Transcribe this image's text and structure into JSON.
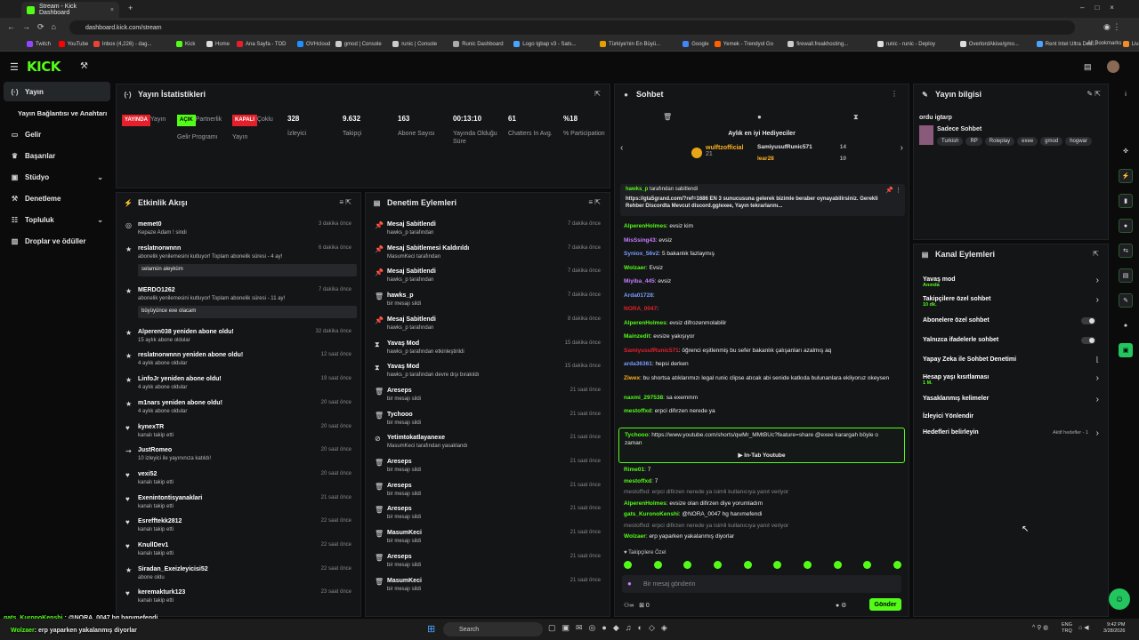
{
  "browser": {
    "tab_title": "Stream - Kick Dashboard",
    "url": "dashboard.kick.com/stream",
    "bookmarks": [
      "Twitch",
      "YouTube",
      "Inbox (4,226) - dag...",
      "Kick",
      "Home",
      "Ana Sayfa - TOD",
      "OVHcloud",
      "gmod | Console",
      "runic | Console",
      "Runic Dashboard",
      "Logo Igbap v3 - Sats...",
      "Türkiye'nin En Büyü...",
      "Google",
      "Yemek - Trendyol Go",
      "firewall.freakhosting...",
      "runic - runic - Deploy",
      "OverlordAkise/gmo...",
      "Rent Intel Ultra Ded...",
      "Livad For Streamers"
    ],
    "all_bookmarks": "All Bookmarks"
  },
  "app": {
    "logo": "KICK"
  },
  "sidebar": {
    "items": [
      {
        "label": "Yayın",
        "active": true
      },
      {
        "label": "Yayın Bağlantısı ve Anahtarı"
      },
      {
        "label": "Gelir"
      },
      {
        "label": "Başarılar"
      },
      {
        "label": "Stüdyo"
      },
      {
        "label": "Denetleme"
      },
      {
        "label": "Topluluk"
      },
      {
        "label": "Droplar ve ödüller"
      }
    ]
  },
  "stats": {
    "title": "Yayın İstatistikleri",
    "items": [
      {
        "value": "YAYINDA",
        "label": "Yayın",
        "color": "#e5202b"
      },
      {
        "value": "AÇIK",
        "label": "Partnerlik Gelir Programı",
        "color": "#53fc18"
      },
      {
        "value": "KAPALI",
        "label": "Çoklu Yayın",
        "color": "#e5202b"
      },
      {
        "value": "328",
        "label": "İzleyici"
      },
      {
        "value": "9.632",
        "label": "Takipçi"
      },
      {
        "value": "163",
        "label": "Abone Sayısı"
      },
      {
        "value": "00:13:10",
        "label": "Yayında Olduğu Süre"
      },
      {
        "value": "61",
        "label": "Chatters In Avg."
      },
      {
        "value": "%18",
        "label": "% Participation"
      }
    ]
  },
  "activity": {
    "title": "Etkinlik Akışı",
    "items": [
      {
        "t": "memet0",
        "s": "Kepaze Adam ! sindi",
        "time": "3 dakika önce"
      },
      {
        "t": "reslatnorwnnn",
        "s": "abonelik yenilemesini kutluyor! Toplam abonelik süresi - 4 ay!",
        "q": "selamün aleyküm",
        "time": "6 dakika önce"
      },
      {
        "t": "MERDO1262",
        "s": "abonelik yenilemesini kutluyor! Toplam abonelik süresi - 11 ay!",
        "q": "büyüyünce exe olacam",
        "time": "7 dakika önce"
      },
      {
        "t": "Alperen038 yeniden abone oldu!",
        "s": "15 aylık abone oldular",
        "time": "32 dakika önce"
      },
      {
        "t": "reslatnorwnnn yeniden abone oldu!",
        "s": "4 aylık abone oldular",
        "time": "12 saat önce"
      },
      {
        "t": "LinfoJr yeniden abone oldu!",
        "s": "4 aylık abone oldular",
        "time": "19 saat önce"
      },
      {
        "t": "m1nars yeniden abone oldu!",
        "s": "4 aylık abone oldular",
        "time": "20 saat önce"
      },
      {
        "t": "kynexTR",
        "s": "kanalı takip etti",
        "time": "20 saat önce"
      },
      {
        "t": "JustRomeo",
        "s": "10 izleyici ile yayınınıza katıldı!",
        "time": "20 saat önce"
      },
      {
        "t": "vexi52",
        "s": "kanalı takip etti",
        "time": "20 saat önce"
      },
      {
        "t": "Exenintontisyanaklari",
        "s": "kanalı takip etti",
        "time": "21 saat önce"
      },
      {
        "t": "Esrefftekk2812",
        "s": "kanalı takip etti",
        "time": "22 saat önce"
      },
      {
        "t": "KnullDev1",
        "s": "kanalı takip etti",
        "time": "22 saat önce"
      },
      {
        "t": "Siradan_Exeizleyicisi52",
        "s": "abone oldu",
        "time": "22 saat önce"
      },
      {
        "t": "keremakturk123",
        "s": "kanalı takip etti",
        "time": "23 saat önce"
      }
    ]
  },
  "modlog": {
    "title": "Denetim Eylemleri",
    "items": [
      {
        "t": "Mesaj Sabitlendi",
        "s": "hawks_p tarafından",
        "time": "7 dakika önce"
      },
      {
        "t": "Mesaj Sabitlemesi Kaldırıldı",
        "s": "MasumKeci tarafından",
        "time": "7 dakika önce"
      },
      {
        "t": "Mesaj Sabitlendi",
        "s": "hawks_p tarafından",
        "time": "7 dakika önce"
      },
      {
        "t": "hawks_p",
        "s": "bir mesajı sildi",
        "time": "7 dakika önce"
      },
      {
        "t": "Mesaj Sabitlendi",
        "s": "hawks_p tarafından",
        "time": "8 dakika önce"
      },
      {
        "t": "Yavaş Mod",
        "s": "hawks_p tarafından etkinleştirildi",
        "time": "15 dakika önce"
      },
      {
        "t": "Yavaş Mod",
        "s": "hawks_p tarafından devre dışı bırakıldı",
        "time": "15 dakika önce"
      },
      {
        "t": "Areseps",
        "s": "bir mesajı sildi",
        "time": "21 saat önce"
      },
      {
        "t": "Tychooo",
        "s": "bir mesajı sildi",
        "time": "21 saat önce"
      },
      {
        "t": "Yetimtokatlayanexe",
        "s": "MasumKeci tarafından yasaklandı",
        "time": "21 saat önce"
      },
      {
        "t": "Areseps",
        "s": "bir mesajı sildi",
        "time": "21 saat önce"
      },
      {
        "t": "Areseps",
        "s": "bir mesajı sildi",
        "time": "21 saat önce"
      },
      {
        "t": "Areseps",
        "s": "bir mesajı sildi",
        "time": "21 saat önce"
      },
      {
        "t": "MasumKeci",
        "s": "bir mesajı sildi",
        "time": "21 saat önce"
      },
      {
        "t": "Areseps",
        "s": "bir mesajı sildi",
        "time": "21 saat önce"
      },
      {
        "t": "MasumKeci",
        "s": "bir mesajı sildi",
        "time": "21 saat önce"
      }
    ]
  },
  "chat": {
    "title": "Sohbet",
    "gifters_title": "Aylık en iyi Hediyeciler",
    "gifters": [
      {
        "name": "wulftzofficial",
        "n": "21"
      },
      {
        "name": "SamiyusufRunic571",
        "n": "14"
      },
      {
        "name": "lear28",
        "n": "10"
      }
    ],
    "pinned_user": "hawks_p",
    "pinned_by": "tarafından sabitlendi",
    "pinned_text": "https://gta5grand.com/?ref=1686 EN 3 sunucusuna gelerek bizimle beraber oynayabilirsiniz. Gerekli Rehber Discordta Mevcut discord.gg/exee, Yayın tekrarlarını...",
    "messages": [
      {
        "u": "AlperenHolmes",
        "c": "#53fc18",
        "m": "evsiz kim"
      },
      {
        "u": "MisSsing43",
        "c": "#c77dff",
        "m": "evsiz"
      },
      {
        "u": "Syniox_56v2",
        "c": "#7b9cff",
        "m": "5 bakanlık fazlaymış"
      },
      {
        "u": "Wolzaer",
        "c": "#53fc18",
        "m": "Evsiz"
      },
      {
        "u": "Miyiba_445",
        "c": "#c77dff",
        "m": "evsiz"
      },
      {
        "u": "Arda01728",
        "c": "#7b9cff",
        "m": ""
      },
      {
        "u": "NORA_0047",
        "c": "#e5202b",
        "m": ""
      },
      {
        "u": "AlperenHolmes",
        "c": "#53fc18",
        "m": "evsiz difrozenmolabilir"
      },
      {
        "u": "Mainzedit",
        "c": "#53fc18",
        "m": "evsize yakışıyor"
      },
      {
        "u": "SamiyusufRunic571",
        "c": "#e5202b",
        "m": "öğrenci eşitlenmiş bu sefer bakanlık çalışanları azalmış aq"
      },
      {
        "u": "arda36361",
        "c": "#7b9cff",
        "m": "hepsi derken"
      },
      {
        "u": "Ziwex",
        "c": "#ffb020",
        "m": "bu shortsa atıklarımızı legal runic clipse atıcak abi senide katkıda bulunanlara ekliyoruz okeysen"
      },
      {
        "u": "naxmi_297538",
        "c": "#53fc18",
        "m": "sa exemmm"
      },
      {
        "u": "mestoffxd",
        "c": "#53fc18",
        "m": "erpci difırzen nerede ya"
      }
    ],
    "highlight_user": "Tychooo",
    "highlight_text": "https://www.youtube.com/shorts/qwMr_MMtBUc?feature=share @exee karargah böyle o zaman",
    "highlight_button": "In-Tab Youtube",
    "messages2": [
      {
        "u": "Rime01",
        "c": "#53fc18",
        "m": "7"
      },
      {
        "u": "mestoffxd",
        "c": "#53fc18",
        "m": "7"
      },
      {
        "u": "",
        "c": "#888",
        "m": "mestoffxd: erpci difirzen nerede ya isimli kullanıcıya yanıt veriyor"
      },
      {
        "u": "AlperenHolmes",
        "c": "#53fc18",
        "m": "evsize olan difirzen diye yorumladım"
      },
      {
        "u": "gats_KuronoKenshi",
        "c": "#53fc18",
        "m": "@NORA_0047 hg hanımefendi"
      },
      {
        "u": "",
        "c": "#888",
        "m": "mestoffxd: erpci difirzen nerede ya isimli kullanıcıya yanıt veriyor"
      },
      {
        "u": "Wolzaer",
        "c": "#53fc18",
        "m": "erp yaparken yakalanmış diyorlar"
      }
    ],
    "followers_only": "Takipçilere Özel",
    "input_placeholder": "Bir mesaj gönderin",
    "send": "Gönder",
    "points": "0"
  },
  "info": {
    "title": "Yayın bilgisi",
    "stream_title": "ordu igtarp",
    "category": "Sadece Sohbet",
    "tags": [
      "Turkish",
      "RP",
      "Roleplay",
      "exee",
      "gmod",
      "hogwar"
    ]
  },
  "actions": {
    "title": "Kanal Eylemleri",
    "items": [
      {
        "l": "Yavaş mod",
        "s": "Anında",
        "type": "chev"
      },
      {
        "l": "Takipçilere özel sohbet",
        "s": "10 dk.",
        "type": "chev"
      },
      {
        "l": "Abonelere özel sohbet",
        "type": "toggle"
      },
      {
        "l": "Yalnızca ifadelerle sohbet",
        "type": "toggle"
      },
      {
        "l": "Yapay Zeka ile Sohbet Denetimi",
        "type": "chart"
      },
      {
        "l": "Hesap yaşı kısıtlaması",
        "s": "1 M.",
        "type": "chev"
      },
      {
        "l": "Yasaklanmış kelimeler",
        "type": "chev"
      },
      {
        "l": "İzleyici Yönlendir",
        "type": "none"
      },
      {
        "l": "Hedefleri belirleyin",
        "extra": "Aktif hedefler - 1",
        "type": "chev"
      }
    ]
  },
  "overlay": {
    "l1u": "gats_KuronoKenshi",
    "l1": "@NORA_0047 hg hanımefendi",
    "l2u": "Wolzaer",
    "l2": "erp yaparken yakalanmış diyorlar"
  },
  "taskbar": {
    "search": "Search",
    "lang1": "ENG",
    "lang2": "TRQ",
    "time": "9:42 PM",
    "date": "3/28/2026"
  }
}
